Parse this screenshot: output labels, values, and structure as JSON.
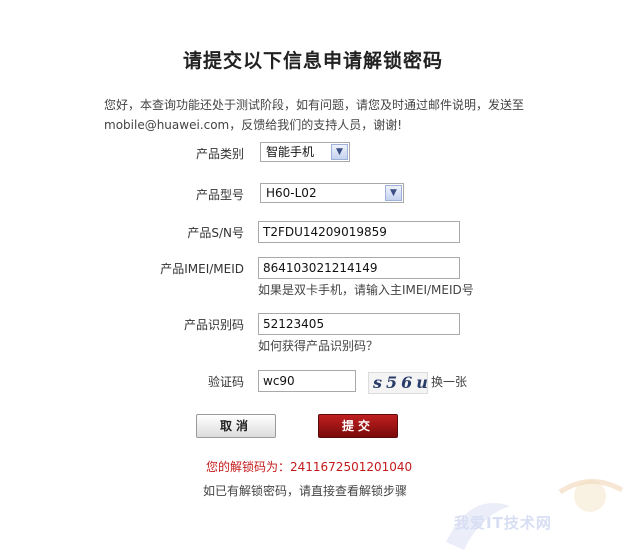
{
  "page": {
    "title": "请提交以下信息申请解锁密码",
    "intro": "您好，本查询功能还处于测试阶段，如有问题，请您及时通过邮件说明，发送至mobile@huawei.com，反馈给我们的支持人员，谢谢!"
  },
  "form": {
    "category": {
      "label": "产品类别",
      "value": "智能手机"
    },
    "model": {
      "label": "产品型号",
      "value": "H60-L02"
    },
    "sn": {
      "label": "产品S/N号",
      "value": "T2FDU14209019859"
    },
    "imei": {
      "label": "产品IMEI/MEID",
      "value": "864103021214149",
      "hint": "如果是双卡手机，请输入主IMEI/MEID号"
    },
    "product_id": {
      "label": "产品识别码",
      "value": "52123405",
      "hint": "如何获得产品识别码？"
    },
    "captcha": {
      "label": "验证码",
      "value": "wc90",
      "image_text": "s56u",
      "refresh": "换一张"
    }
  },
  "buttons": {
    "cancel": "取消",
    "submit": "提交"
  },
  "result": {
    "text": "您的解锁码为：2411672501201040"
  },
  "footer": {
    "text": "如已有解锁密码，请直接查看解锁步骤"
  },
  "watermark": {
    "text": "我爱IT技术网"
  },
  "colors": {
    "submit": "#9a1010",
    "result": "#c41a1a"
  }
}
